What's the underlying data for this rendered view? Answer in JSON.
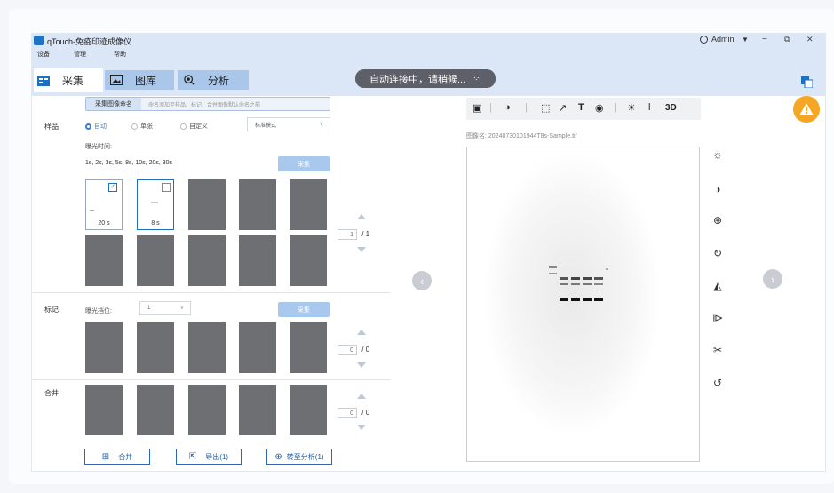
{
  "titlebar": {
    "app_title": "qTouch-免疫印迹成像仪",
    "user": "Admin",
    "minimize": "−",
    "restore": "⧉",
    "close": "✕"
  },
  "menu": [
    "设备",
    "管理",
    "帮助"
  ],
  "tabs": [
    {
      "label": "采集",
      "icon": "grid-icon"
    },
    {
      "label": "图库",
      "icon": "image-icon"
    },
    {
      "label": "分析",
      "icon": "analyze-icon"
    }
  ],
  "status": {
    "text": "自动连接中，请稍候...",
    "icon": "loading-spinner-icon"
  },
  "capture": {
    "name_button": "采集图像命名",
    "name_hint": "命名添加至样品、标记、合并图像默认命名之前",
    "sample_label": "样品",
    "modes": [
      "自动",
      "单张",
      "自定义"
    ],
    "selected_mode": "自动",
    "select_value": "标准模式",
    "exposure_label": "曝光时间:",
    "exposure_list": "1s,  2s,  3s,  5s,  8s,  10s,  20s,  30s",
    "capture_button": "采集",
    "thumb_labels": [
      "20 s",
      "8 s"
    ],
    "pager_current": "1",
    "pager_total": "/ 1"
  },
  "marker": {
    "label": "标记",
    "gear_label": "曝光挡位:",
    "gear_value": "1",
    "capture_button": "采集",
    "pager_current": "0",
    "pager_total": "/ 0"
  },
  "merge": {
    "label": "合并",
    "pager_current": "0",
    "pager_total": "/ 0"
  },
  "bottom_buttons": [
    {
      "label": "合并",
      "icon": "merge-icon"
    },
    {
      "label": "导出(1)",
      "icon": "export-icon"
    },
    {
      "label": "转至分析(1)",
      "icon": "analyze-icon"
    }
  ],
  "viewer": {
    "filename": "图像名: 20240730101944T8s-Sample.tif",
    "toolbar_icons": [
      "image-icon",
      "contrast-icon",
      "select-icon",
      "arrow-icon",
      "text-icon",
      "eye-icon",
      "brightness-icon",
      "histogram-icon",
      "3d-icon"
    ],
    "toolbar_3d_label": "3D",
    "toolbar_text_label": "T",
    "side_tools": [
      "brightness-icon",
      "contrast-icon",
      "zoom-icon",
      "rotate-icon",
      "flip-vertical-icon",
      "flip-horizontal-icon",
      "crop-icon",
      "reset-icon"
    ]
  },
  "colors": {
    "accent": "#1f6fc0",
    "tabbar": "#dbe6f6",
    "warning": "#f5a623"
  }
}
